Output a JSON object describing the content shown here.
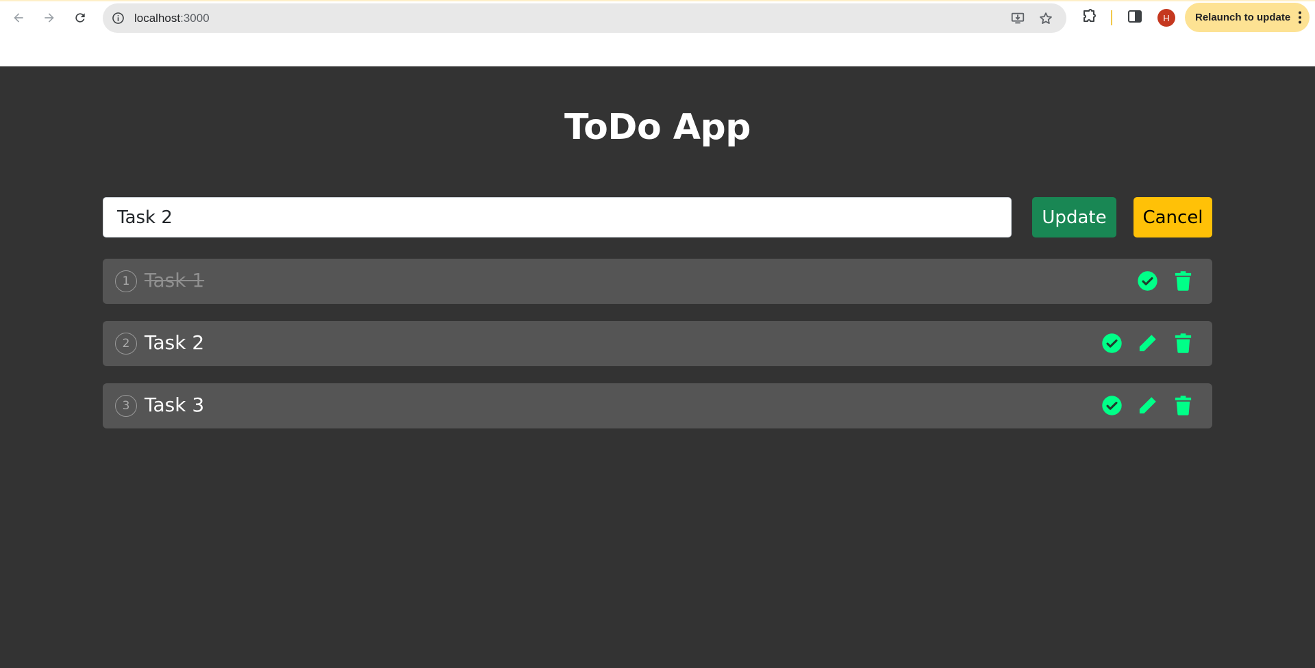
{
  "browser": {
    "url_host": "localhost",
    "url_port": ":3000",
    "avatar_letter": "H",
    "relaunch_label": "Relaunch to update"
  },
  "app": {
    "title": "ToDo App",
    "input_value": "Task 2",
    "update_label": "Update",
    "cancel_label": "Cancel",
    "accent_color": "#00ff88",
    "tasks": [
      {
        "number": "1",
        "text": "Task 1",
        "done": true
      },
      {
        "number": "2",
        "text": "Task 2",
        "done": false
      },
      {
        "number": "3",
        "text": "Task 3",
        "done": false
      }
    ]
  }
}
